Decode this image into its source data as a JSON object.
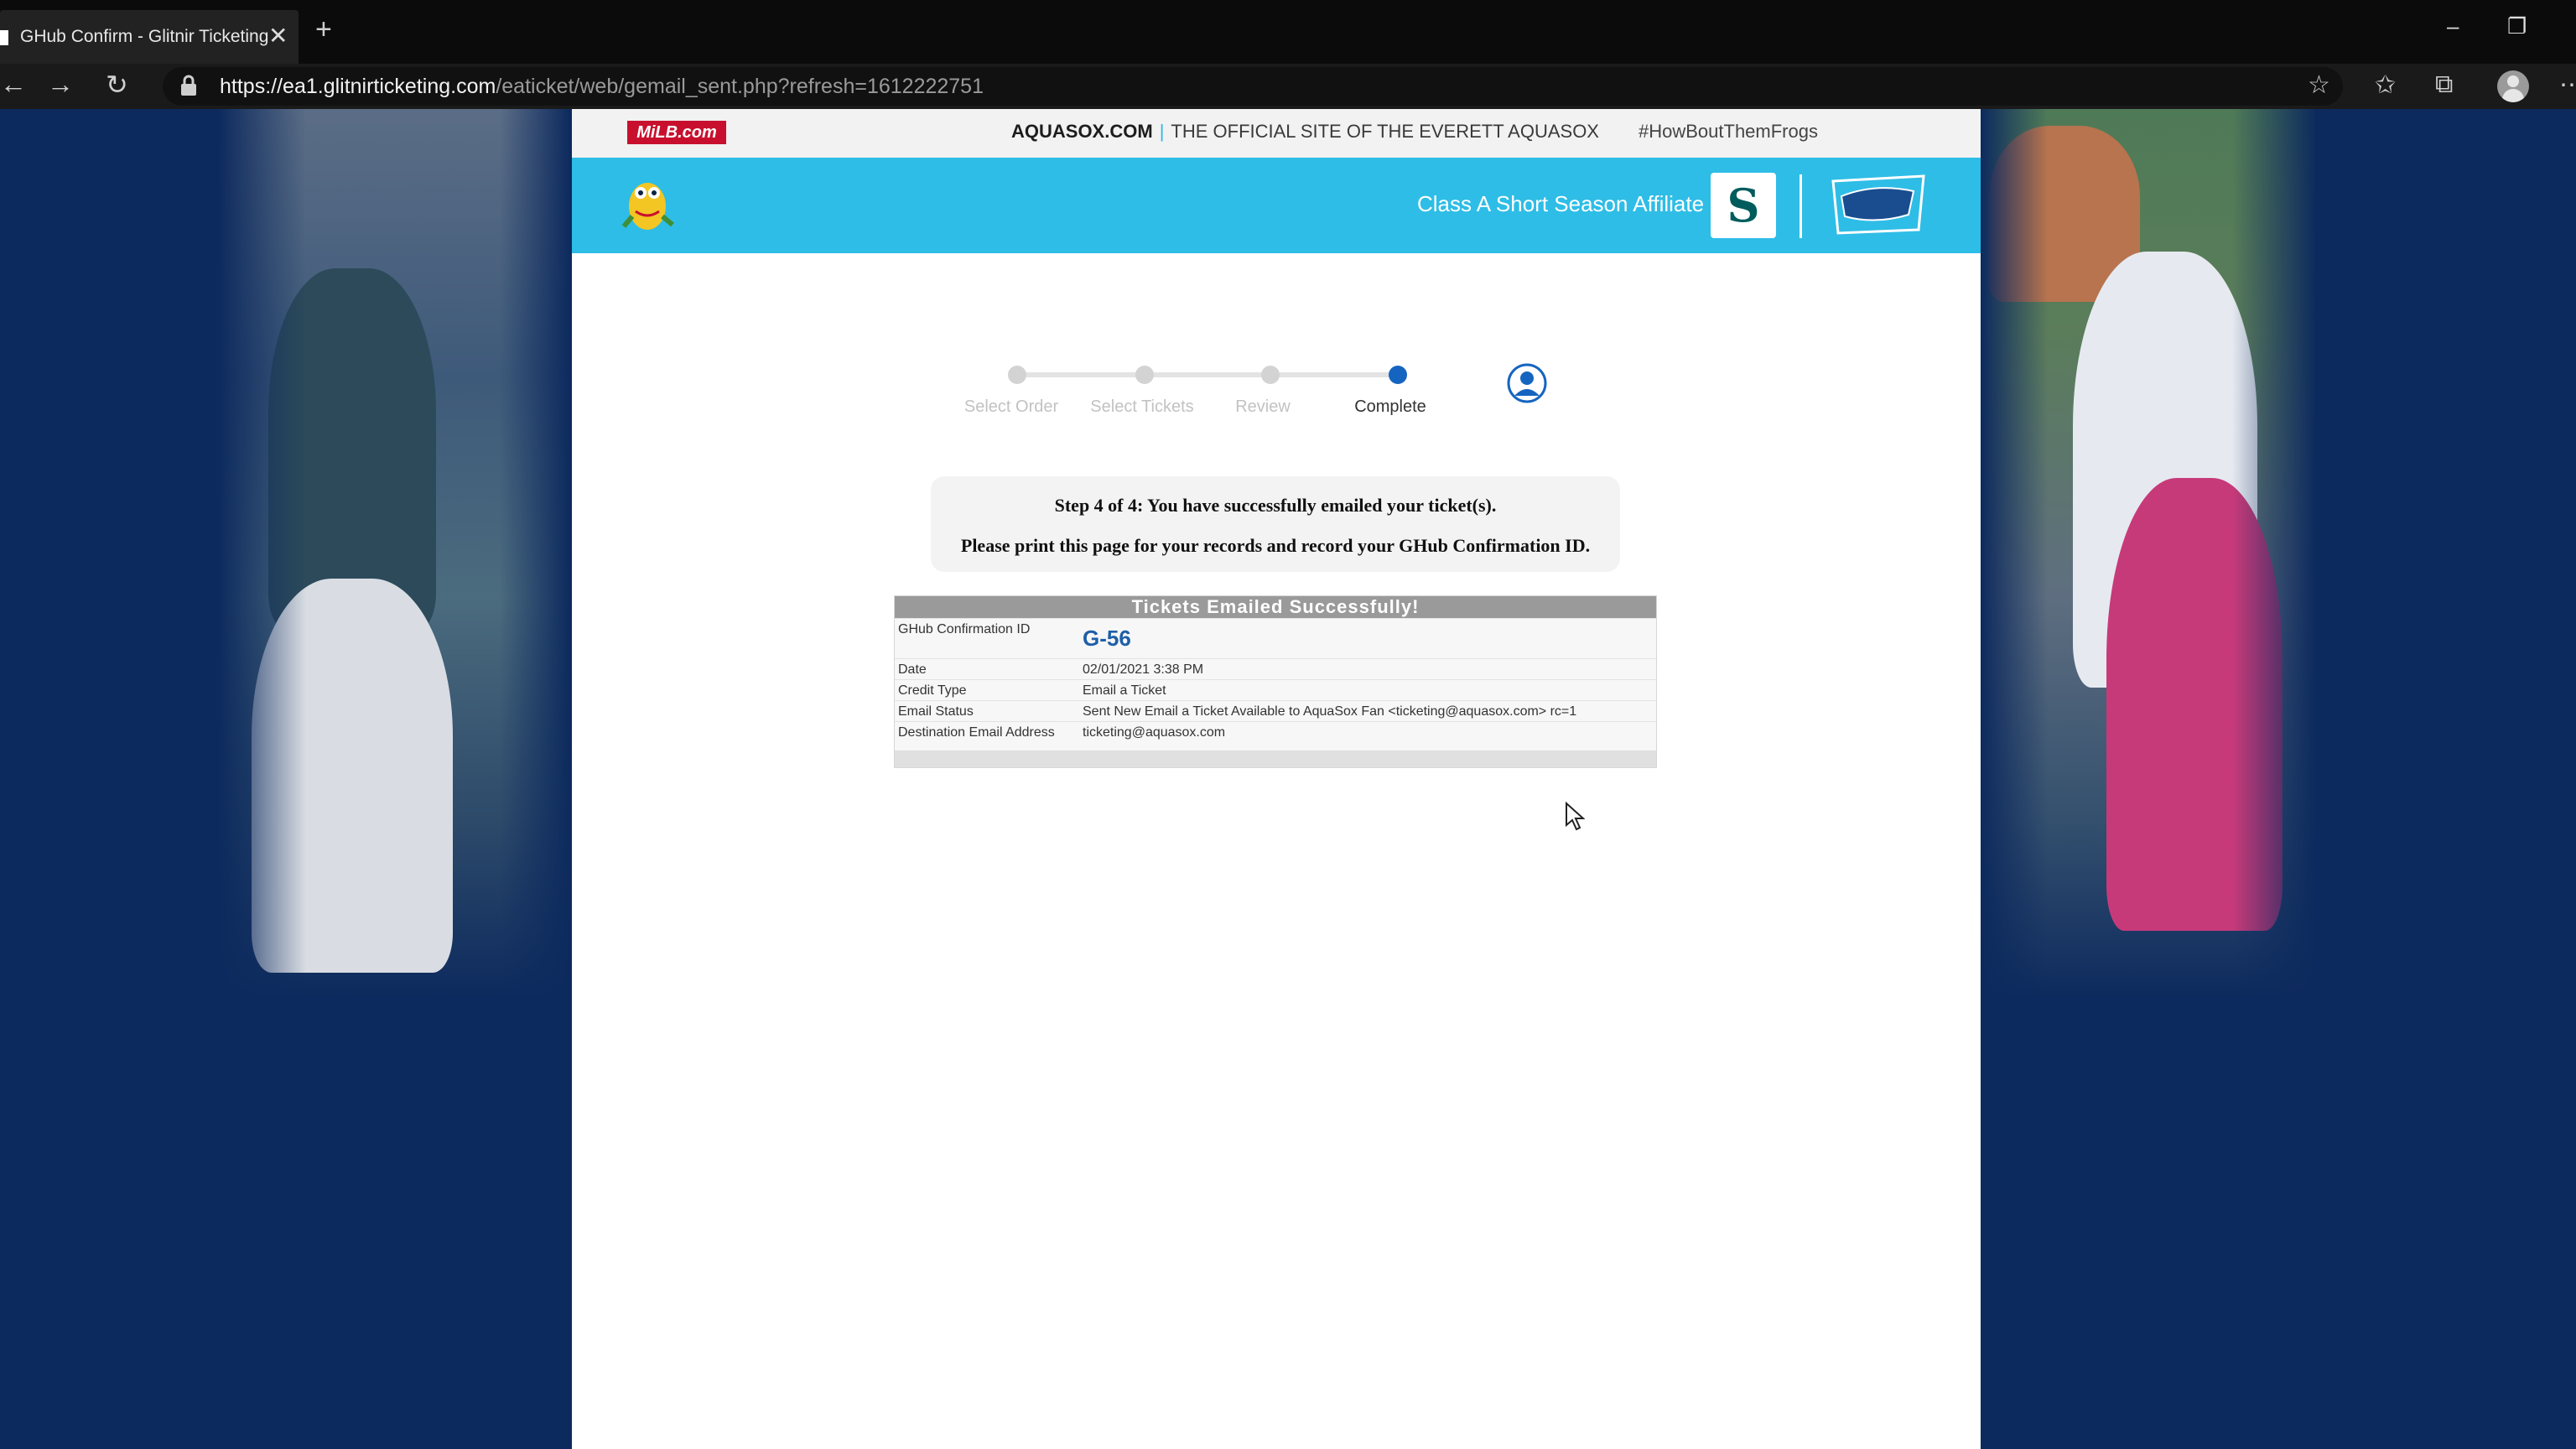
{
  "browser": {
    "tab_title": "GHub Confirm - Glitnir Ticketing",
    "new_tab": "+",
    "close": "✕",
    "url_host": "https://ea1.glitnirticketing.com",
    "url_path": "/eaticket/web/gemail_sent.php?refresh=1612222751",
    "minimize": "–",
    "restore": "❐",
    "back": "←",
    "forward": "→",
    "reload": "↻",
    "add_favorite": "☆",
    "favorites": "✩",
    "collections": "⧉",
    "menu": "⋯"
  },
  "site": {
    "milb_logo": "MiLB.com",
    "domain": "AQUASOX.COM",
    "separator": "|",
    "tagline": "THE OFFICIAL SITE OF THE EVERETT AQUASOX",
    "hashtag": "#HowBoutThemFrogs",
    "affiliate": "Class A Short Season Affiliate",
    "mariners_logo": "S"
  },
  "stepper": {
    "steps": [
      {
        "label": "Select Order",
        "active": false
      },
      {
        "label": "Select Tickets",
        "active": false
      },
      {
        "label": "Review",
        "active": false
      },
      {
        "label": "Complete",
        "active": true
      }
    ]
  },
  "message": {
    "line1": "Step 4 of 4: You have successfully emailed your ticket(s).",
    "line2": "Please print this page for your records and record your GHub Confirmation ID."
  },
  "confirmation": {
    "heading": "Tickets Emailed Successfully!",
    "rows": [
      {
        "label": "GHub Confirmation ID",
        "value": "G-56"
      },
      {
        "label": "Date",
        "value": "02/01/2021 3:38 PM"
      },
      {
        "label": "Credit Type",
        "value": "Email a Ticket"
      },
      {
        "label": "Email Status",
        "value": "Sent New Email a Ticket Available to AquaSox Fan <ticketing@aquasox.com> rc=1"
      },
      {
        "label": "Destination Email Address",
        "value": "ticketing@aquasox.com"
      }
    ]
  },
  "colors": {
    "page_bg": "#0d2a5e",
    "hero": "#2ebde6",
    "active_step": "#1565c0",
    "table_header": "#9a9a9a",
    "confirmation_id": "#1e5fa8"
  }
}
